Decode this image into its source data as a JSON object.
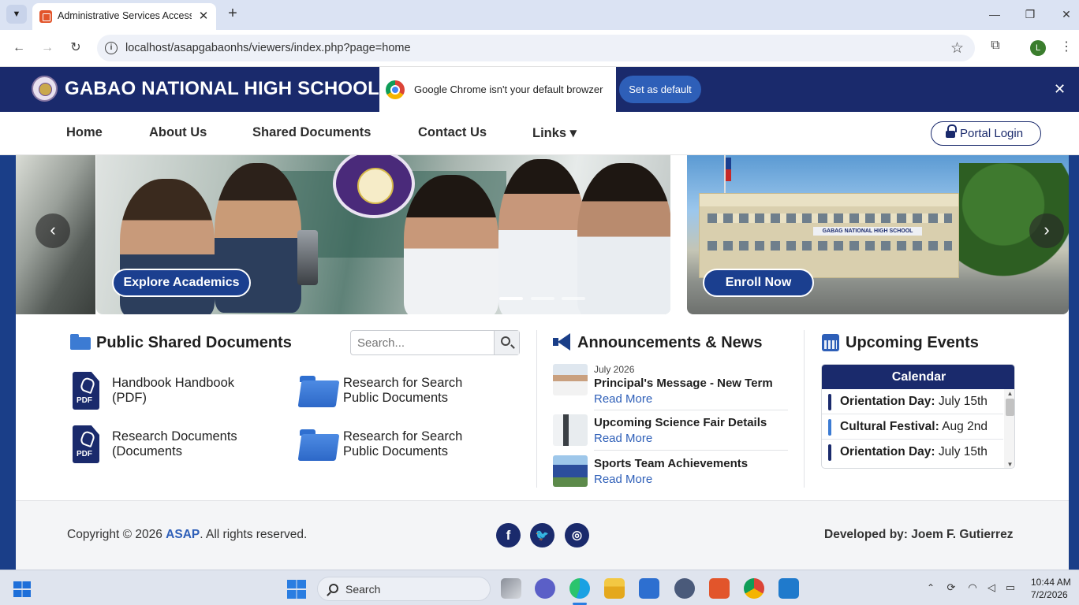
{
  "browser": {
    "tab_title": "Administrative Services Access S",
    "url": "localhost/asapgabaonhs/viewers/index.php?page=home",
    "profile_initial": "L"
  },
  "header": {
    "school_name": "GABAO NATIONAL HIGH SCHOOL",
    "chrome_banner_text": "Google Chrome isn't your default browzer",
    "set_default_label": "Set as default"
  },
  "nav": {
    "items": [
      {
        "label": "Home"
      },
      {
        "label": "About Us"
      },
      {
        "label": "Shared Documents"
      },
      {
        "label": "Contact Us"
      },
      {
        "label": "Links ▾"
      }
    ],
    "portal_label": "Portal Login"
  },
  "carousel": {
    "explore_label": "Explore Academics",
    "enroll_label": "Enroll Now",
    "building_sign": "GABAG NATIONAL HIGH SCHOOL",
    "active_slide": 1,
    "slide_count": 3
  },
  "documents": {
    "title": "Public Shared Documents",
    "search_placeholder": "Search...",
    "items": [
      {
        "label": "Handbook Handbook (PDF)",
        "icon": "pdf-icon"
      },
      {
        "label": "Research for Search Public Documents",
        "icon": "folder-icon"
      },
      {
        "label": "Research Documents (Documents",
        "icon": "pdf-icon"
      },
      {
        "label": "Research for Search Public Documents",
        "icon": "folder-icon"
      }
    ]
  },
  "news": {
    "title": "Announcements & News",
    "items": [
      {
        "date": "July 2026",
        "title": "Principal's Message - New Term",
        "link": "Read More"
      },
      {
        "date": "",
        "title": "Upcoming Science Fair Details",
        "link": "Read More"
      },
      {
        "date": "",
        "title": "Sports Team Achievements",
        "link": "Read More"
      }
    ]
  },
  "events": {
    "title": "Upcoming Events",
    "calendar_label": "Calendar",
    "items": [
      {
        "name": "Orientation Day:",
        "date": " July 15th",
        "color": "#1a2a6c"
      },
      {
        "name": "Cultural Festival:",
        "date": " Aug 2nd",
        "color": "#3c7bd3"
      },
      {
        "name": "Orientation Day:",
        "date": " July 15th",
        "color": "#1a2a6c"
      }
    ]
  },
  "footer": {
    "copyright_prefix": "Copyright © 2026 ",
    "copyright_brand": "ASAP",
    "copyright_suffix": ". All rights reserved.",
    "developer": "Developed by: Joem F. Gutierrez",
    "social": [
      "facebook-icon",
      "twitter-icon",
      "instagram-icon"
    ]
  },
  "taskbar": {
    "search_label": "Search",
    "time": "10:44 AM",
    "date": "7/2/2026"
  },
  "colors": {
    "brand_navy": "#1a2a6c",
    "accent_blue": "#2e5fb8",
    "folder_blue": "#3c7bd3"
  }
}
